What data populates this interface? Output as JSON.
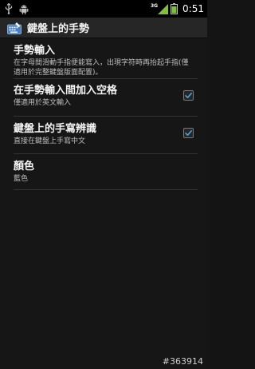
{
  "status_bar": {
    "network_type": "3G",
    "time": "0:51",
    "icons": [
      "usb-icon",
      "android-debug-icon",
      "signal-icon",
      "battery-icon"
    ]
  },
  "header": {
    "icon": "keyboard-icon",
    "title": "鍵盤上的手勢"
  },
  "settings": [
    {
      "title": "手勢輸入",
      "summary": "在字母間滑動手指便能寫入，出現字符時再抬起手指(僅適用於完整鍵盤版面配置)。",
      "has_checkbox": false
    },
    {
      "title": "在手勢輸入間加入空格",
      "summary": "僅適用於英文輸入",
      "has_checkbox": true,
      "checked": true
    },
    {
      "title": "鍵盤上的手寫辨識",
      "summary": "直接在鍵盤上手寫中文",
      "has_checkbox": true,
      "checked": true
    },
    {
      "title": "顏色",
      "summary": "藍色",
      "has_checkbox": false
    }
  ],
  "watermark": "#363914",
  "colors": {
    "background": "#161616",
    "title_bar": "#262626",
    "check_accent": "#4aa3df",
    "divider": "#333333"
  }
}
